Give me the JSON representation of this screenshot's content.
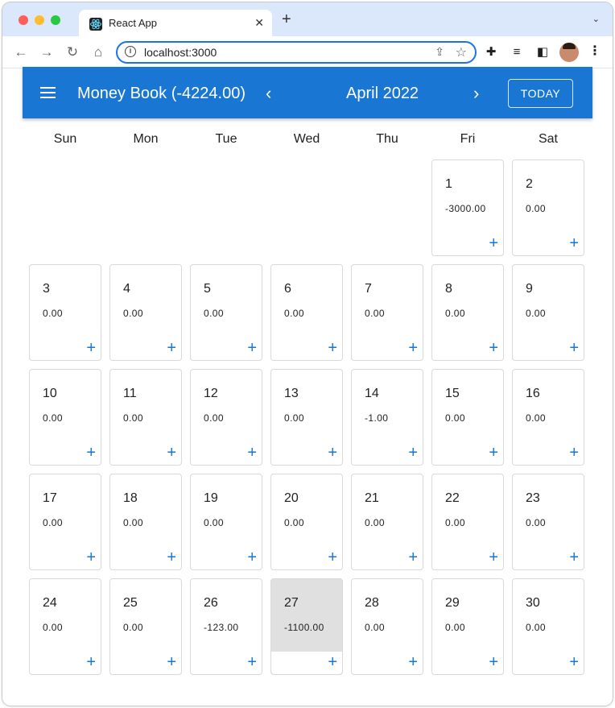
{
  "browser": {
    "tab_title": "React App",
    "new_tab_label": "+",
    "url": "localhost:3000"
  },
  "app": {
    "title": "Money Book (-4224.00)",
    "month": "April 2022",
    "today_label": "TODAY",
    "prev_icon": "chevron-left-icon",
    "next_icon": "chevron-right-icon",
    "accent_color": "#1976d2"
  },
  "weekdays": [
    "Sun",
    "Mon",
    "Tue",
    "Wed",
    "Thu",
    "Fri",
    "Sat"
  ],
  "days": [
    {
      "day": "1",
      "amount": "-3000.00"
    },
    {
      "day": "2",
      "amount": "0.00"
    },
    {
      "day": "3",
      "amount": "0.00"
    },
    {
      "day": "4",
      "amount": "0.00"
    },
    {
      "day": "5",
      "amount": "0.00"
    },
    {
      "day": "6",
      "amount": "0.00"
    },
    {
      "day": "7",
      "amount": "0.00"
    },
    {
      "day": "8",
      "amount": "0.00"
    },
    {
      "day": "9",
      "amount": "0.00"
    },
    {
      "day": "10",
      "amount": "0.00"
    },
    {
      "day": "11",
      "amount": "0.00"
    },
    {
      "day": "12",
      "amount": "0.00"
    },
    {
      "day": "13",
      "amount": "0.00"
    },
    {
      "day": "14",
      "amount": "-1.00"
    },
    {
      "day": "15",
      "amount": "0.00"
    },
    {
      "day": "16",
      "amount": "0.00"
    },
    {
      "day": "17",
      "amount": "0.00"
    },
    {
      "day": "18",
      "amount": "0.00"
    },
    {
      "day": "19",
      "amount": "0.00"
    },
    {
      "day": "20",
      "amount": "0.00"
    },
    {
      "day": "21",
      "amount": "0.00"
    },
    {
      "day": "22",
      "amount": "0.00"
    },
    {
      "day": "23",
      "amount": "0.00"
    },
    {
      "day": "24",
      "amount": "0.00"
    },
    {
      "day": "25",
      "amount": "0.00"
    },
    {
      "day": "26",
      "amount": "-123.00"
    },
    {
      "day": "27",
      "amount": "-1100.00",
      "today": true
    },
    {
      "day": "28",
      "amount": "0.00"
    },
    {
      "day": "29",
      "amount": "0.00"
    },
    {
      "day": "30",
      "amount": "0.00"
    }
  ],
  "add_label": "+"
}
